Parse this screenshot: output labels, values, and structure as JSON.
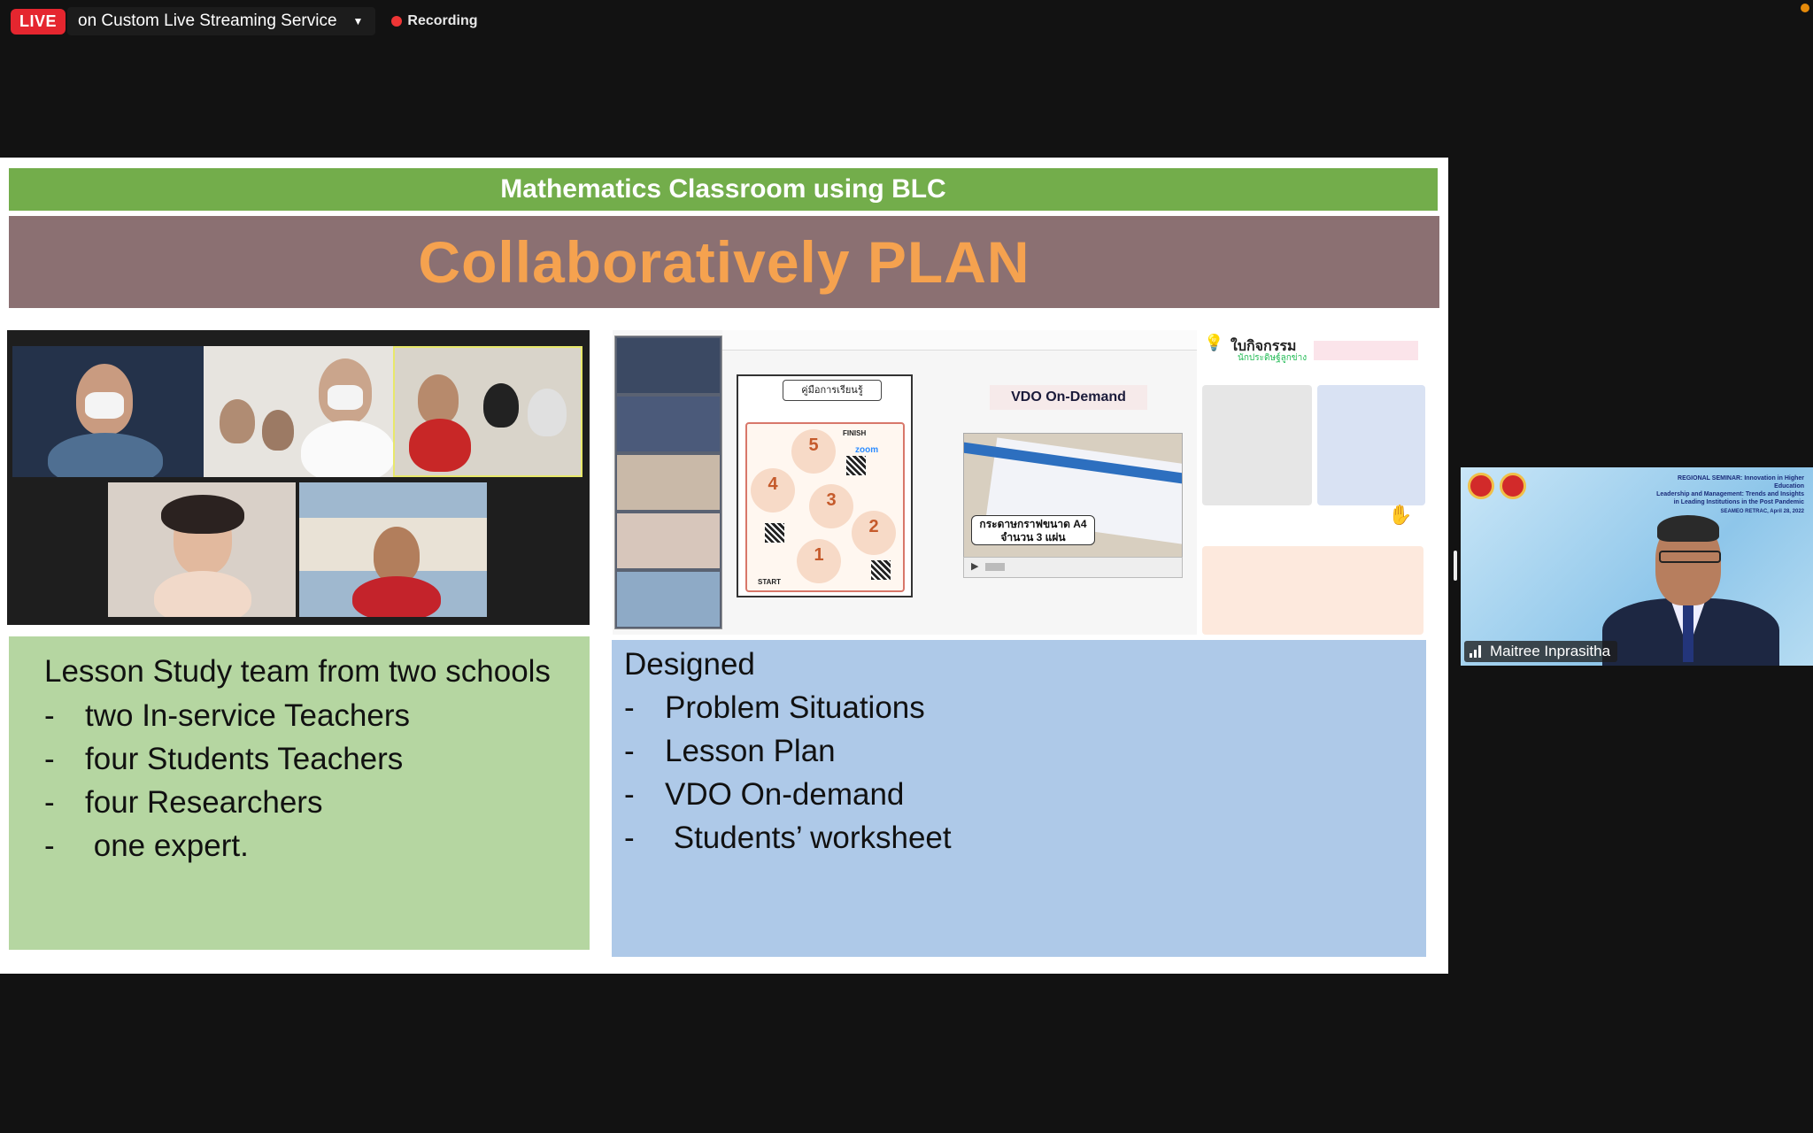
{
  "topbar": {
    "live_label": "LIVE",
    "stream_service": "on Custom Live Streaming Service",
    "recording_label": "Recording"
  },
  "slide": {
    "header": "Mathematics Classroom using BLC",
    "title": "Collaboratively PLAN",
    "left_box": {
      "heading": "Lesson Study team from two schools",
      "items": [
        {
          "dash": "-",
          "text": "two In-service Teachers"
        },
        {
          "dash": "-",
          "text": "four Students Teachers"
        },
        {
          "dash": "-",
          "text": "four Researchers"
        },
        {
          "dash": "-",
          "text": " one expert."
        }
      ]
    },
    "right_box": {
      "heading": "Designed",
      "items": [
        {
          "dash": "-",
          "text": "Problem Situations"
        },
        {
          "dash": "-",
          "text": "Lesson Plan"
        },
        {
          "dash": "-",
          "text": "VDO On-demand"
        },
        {
          "dash": "-",
          "text": " Students’ worksheet"
        }
      ]
    },
    "collage": {
      "guide_title": "คู่มือการเรียนรู้",
      "finish_label": "FINISH",
      "zoom_label": "zoom",
      "start_label": "START",
      "steps": [
        "5",
        "4",
        "3",
        "2",
        "1"
      ],
      "vdo_title": "VDO On-Demand",
      "vdo_caption_line1": "กระดาษกราฟขนาด A4",
      "vdo_caption_line2": "จำนวน 3 แผ่น",
      "worksheet_title": "ใบกิจกรรม",
      "worksheet_subtitle": "นักประดิษฐ์ลูกข่าง"
    }
  },
  "speaker": {
    "name": "Maitree Inprasitha",
    "banner_line1": "REGIONAL SEMINAR: Innovation in Higher Education",
    "banner_line2": "Leadership and Management: Trends and Insights",
    "banner_line3": "in Leading Institutions in the Post Pandemic",
    "banner_line4": "SEAMEO RETRAC, April 28, 2022"
  },
  "colors": {
    "live_red": "#e5262f",
    "slide_green": "#73ad4b",
    "slide_mauve": "#8b7072",
    "title_orange": "#f5a24f",
    "left_box": "#b5d6a1",
    "right_box": "#aec9e8"
  },
  "icons": {
    "dropdown": "chevron-down-icon",
    "recording": "record-dot-icon",
    "signal": "signal-bars-icon",
    "hand": "raise-hand-icon"
  }
}
